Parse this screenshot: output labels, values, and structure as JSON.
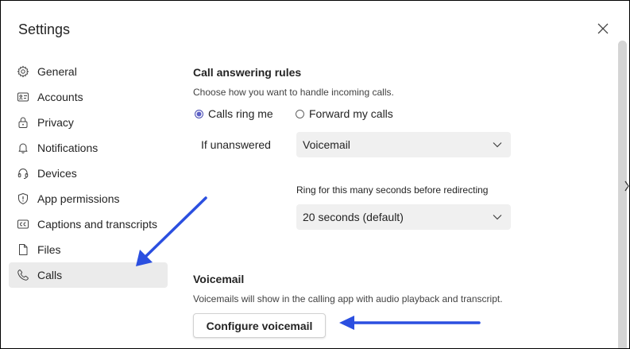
{
  "dialog": {
    "title": "Settings"
  },
  "sidebar": {
    "items": [
      {
        "label": "General",
        "icon": "gear-icon"
      },
      {
        "label": "Accounts",
        "icon": "id-card-icon"
      },
      {
        "label": "Privacy",
        "icon": "lock-icon"
      },
      {
        "label": "Notifications",
        "icon": "bell-icon"
      },
      {
        "label": "Devices",
        "icon": "headset-icon"
      },
      {
        "label": "App permissions",
        "icon": "shield-icon"
      },
      {
        "label": "Captions and transcripts",
        "icon": "cc-icon"
      },
      {
        "label": "Files",
        "icon": "file-icon"
      },
      {
        "label": "Calls",
        "icon": "phone-icon",
        "selected": true
      }
    ]
  },
  "call_answering": {
    "title": "Call answering rules",
    "description": "Choose how you want to handle incoming calls.",
    "options": [
      {
        "label": "Calls ring me",
        "checked": true
      },
      {
        "label": "Forward my calls",
        "checked": false
      }
    ],
    "if_unanswered_label": "If unanswered",
    "if_unanswered_value": "Voicemail",
    "ring_label": "Ring for this many seconds before redirecting",
    "ring_value": "20 seconds (default)"
  },
  "voicemail": {
    "title": "Voicemail",
    "description": "Voicemails will show in the calling app with audio playback and transcript.",
    "button_label": "Configure voicemail"
  },
  "colors": {
    "accent": "#5b5fc7",
    "annotation_arrow": "#2b4fe0",
    "selected_nav_bg": "#ebebeb"
  }
}
